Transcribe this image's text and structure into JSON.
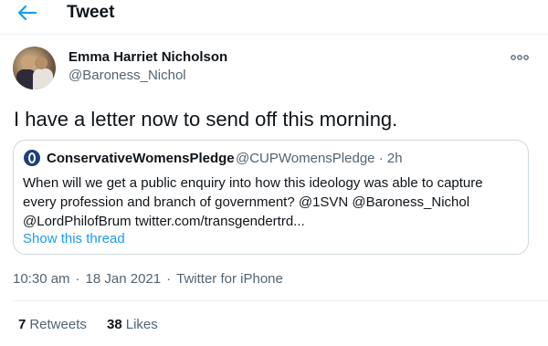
{
  "header": {
    "title": "Tweet",
    "back_icon": "arrow-left-icon",
    "accent": "#1d9bf0"
  },
  "tweet": {
    "author_name": "Emma Harriet Nicholson",
    "author_handle": "@Baroness_Nichol",
    "text": "I have a letter now to send off this morning.",
    "more_icon": "more-options-icon",
    "timestamp": "10:30 am",
    "separator": "·",
    "date": "18 Jan 2021",
    "source": "Twitter for iPhone"
  },
  "quoted": {
    "author_name": "ConservativeWomensPledge",
    "author_handle": "@CUPWomensPledge",
    "separator": "·",
    "age": "2h",
    "lines": [
      "When will we get a public enquiry into how this ideology was able to capture",
      "every profession and branch of government? @1SVN @Baroness_Nichol",
      "@LordPhilofBrum twitter.com/transgendertrd..."
    ],
    "show_thread": "Show this thread"
  },
  "stats": {
    "retweets_count": "7",
    "retweets_label": "Retweets",
    "likes_count": "38",
    "likes_label": "Likes"
  }
}
